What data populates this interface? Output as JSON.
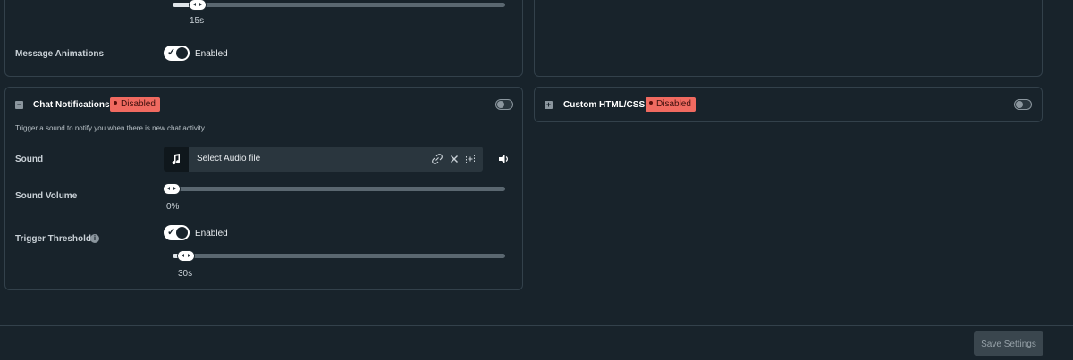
{
  "top_left_panel": {
    "slider_value": "15s",
    "slider_fraction": 0.07,
    "message_animations_label": "Message Animations",
    "message_animations_state": "Enabled"
  },
  "chat_notifications": {
    "title": "Chat Notifications",
    "status_badge": "Disabled",
    "description": "Trigger a sound to notify you when there is new chat activity.",
    "sound_label": "Sound",
    "audio_placeholder": "Select Audio file",
    "sound_volume_label": "Sound Volume",
    "sound_volume_value": "0%",
    "sound_volume_fraction": 0.0,
    "trigger_threshold_label": "Trigger Threshold",
    "trigger_threshold_state": "Enabled",
    "threshold_value": "30s",
    "threshold_fraction": 0.04
  },
  "custom_html_css": {
    "title": "Custom HTML/CSS",
    "status_badge": "Disabled"
  },
  "footer": {
    "save_label": "Save Settings"
  },
  "colors": {
    "background": "#18232b",
    "badge": "#f06a60",
    "panel_border": "#33414b"
  }
}
